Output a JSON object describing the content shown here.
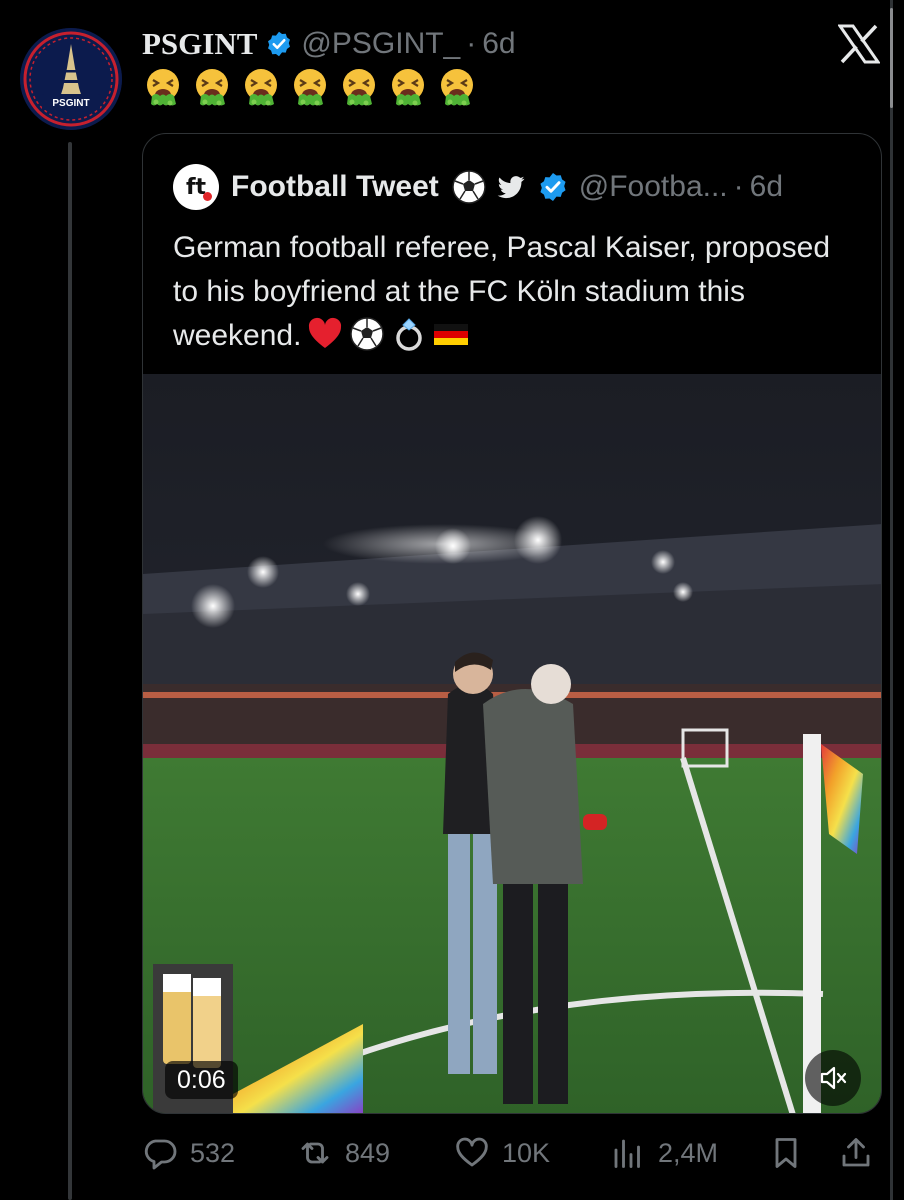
{
  "author": {
    "name": "PSGINT",
    "handle": "@PSGINT_",
    "dot": "·",
    "age": "6d",
    "avatar_text": "PSGINT"
  },
  "post": {
    "emojis": [
      "nauseated-vomiting-face",
      "nauseated-vomiting-face",
      "nauseated-vomiting-face",
      "nauseated-vomiting-face",
      "nauseated-vomiting-face",
      "nauseated-vomiting-face",
      "nauseated-vomiting-face"
    ]
  },
  "quoted": {
    "name": "Football Tweet",
    "logo_text": "ft",
    "handle": "@Footba...",
    "dot": "·",
    "age": "6d",
    "text": "German football referee, Pascal Kaiser, proposed to his boyfriend at the FC Köln stadium this weekend.",
    "text_emojis": [
      "red-heart",
      "soccer-ball",
      "ring",
      "germany-flag"
    ],
    "video": {
      "duration": "0:06",
      "muted": true
    }
  },
  "actions": {
    "replies": "532",
    "reposts": "849",
    "likes": "10K",
    "views": "2,4M"
  },
  "colors": {
    "background": "#000000",
    "text": "#e7e9ea",
    "muted": "#71767b",
    "verified": "#1d9bf0",
    "border": "#2f3336"
  }
}
